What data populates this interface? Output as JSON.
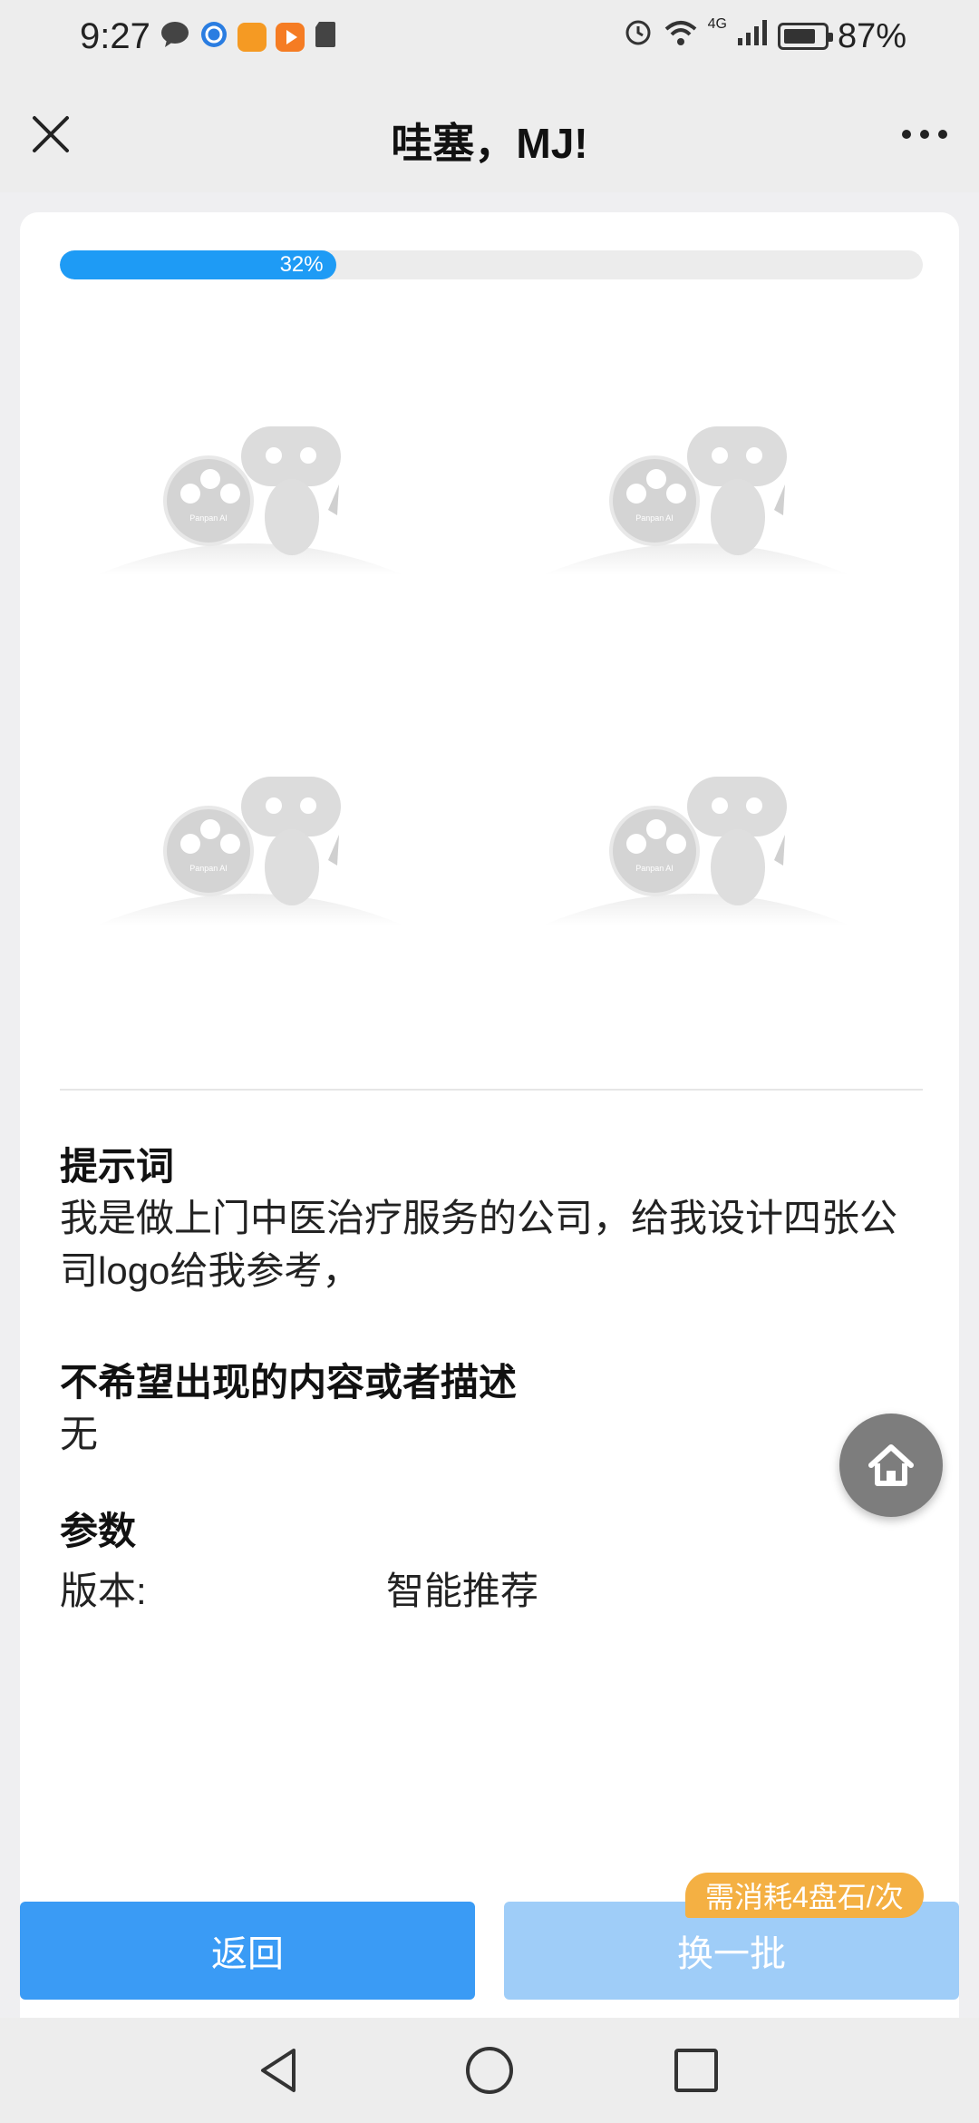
{
  "status_bar": {
    "time": "9:27",
    "battery": "87%",
    "network": "4G",
    "icons": [
      "chat-bubble-icon",
      "browser-icon",
      "orange-app-icon",
      "video-app-icon",
      "sd-card-icon",
      "alarm-icon",
      "wifi-icon",
      "signal-icon",
      "battery-icon"
    ]
  },
  "nav": {
    "title": "哇塞，MJ!",
    "close_icon": "close-icon",
    "more_icon": "more-icon"
  },
  "progress": {
    "value": 0.32,
    "label": "32%",
    "fill_color": "#1e9bf5"
  },
  "placeholders": {
    "watermark": "Panpan AI",
    "count": 4
  },
  "prompt": {
    "title": "提示词",
    "text": "我是做上门中医治疗服务的公司，给我设计四张公司logo给我参考，"
  },
  "negative": {
    "title": "不希望出现的内容或者描述",
    "text": "无"
  },
  "params": {
    "title": "参数",
    "version_label": "版本:",
    "version_value": "智能推荐"
  },
  "buttons": {
    "back": "返回",
    "refresh": "换一批",
    "cost_badge": "需消耗4盘石/次"
  },
  "colors": {
    "primary": "#3a9bf5",
    "primary_disabled": "#9fcdf8",
    "badge": "#f4b043"
  }
}
